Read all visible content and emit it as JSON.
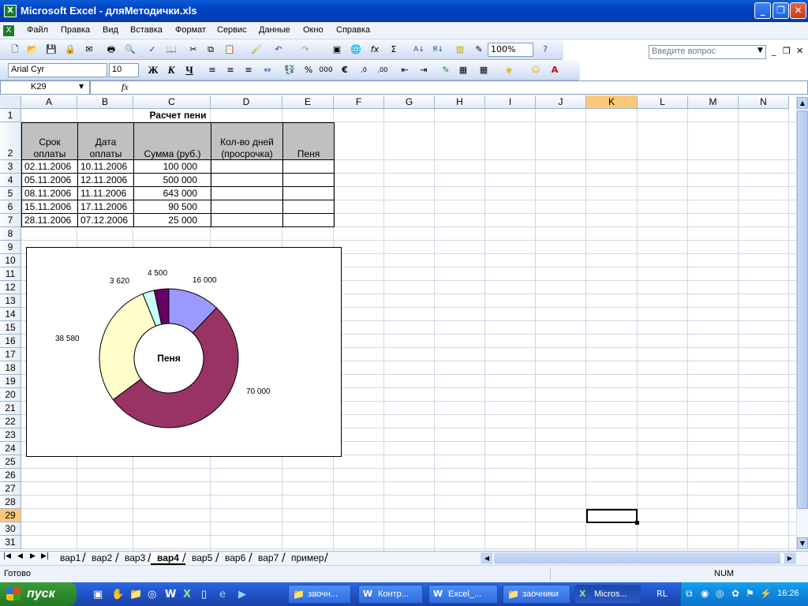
{
  "window": {
    "title": "Microsoft Excel - дляМетодички.xls"
  },
  "menu": {
    "items": [
      "Файл",
      "Правка",
      "Вид",
      "Вставка",
      "Формат",
      "Сервис",
      "Данные",
      "Окно",
      "Справка"
    ],
    "ask_placeholder": "Введите вопрос"
  },
  "toolbar": {
    "zoom": "100%"
  },
  "format_toolbar": {
    "font": "Arial Cyr",
    "size": "10",
    "bold": "Ж",
    "italic": "К",
    "underline": "Ч"
  },
  "formula_bar": {
    "name_box": "K29",
    "fx": "fx",
    "value": ""
  },
  "sheet": {
    "columns": [
      "A",
      "B",
      "C",
      "D",
      "E",
      "F",
      "G",
      "H",
      "I",
      "J",
      "K",
      "L",
      "M",
      "N"
    ],
    "selected_column": "K",
    "selected_row": "29",
    "rows": [
      "1",
      "2",
      "3",
      "4",
      "5",
      "6",
      "7",
      "8",
      "9",
      "10",
      "11",
      "12",
      "13",
      "14",
      "15",
      "16",
      "17",
      "18",
      "19",
      "20",
      "21",
      "22",
      "23",
      "24",
      "25",
      "26",
      "27",
      "28",
      "29",
      "30",
      "31"
    ],
    "title": "Расчет пени",
    "headers": {
      "a1": "Срок",
      "a2": "оплаты",
      "b1": "Дата",
      "b2": "оплаты",
      "c": "Сумма (руб.)",
      "d1": "Кол-во дней",
      "d2": "(просрочка)",
      "e": "Пеня"
    },
    "data": [
      {
        "a": "02.11.2006",
        "b": "10.11.2006",
        "c": "100 000"
      },
      {
        "a": "05.11.2006",
        "b": "12.11.2006",
        "c": "500 000"
      },
      {
        "a": "08.11.2006",
        "b": "11.11.2006",
        "c": "643 000"
      },
      {
        "a": "15.11.2006",
        "b": "17.11.2006",
        "c": "90 500"
      },
      {
        "a": "28.11.2006",
        "b": "07.12.2006",
        "c": "25 000"
      }
    ]
  },
  "chart_data": {
    "type": "pie",
    "title": "Пеня",
    "categories": [
      "",
      "",
      "",
      "",
      ""
    ],
    "values": [
      16000,
      70000,
      38580,
      3620,
      4500
    ],
    "labels": [
      "16 000",
      "70 000",
      "38 580",
      "3 620",
      "4 500"
    ],
    "colors": [
      "#9999ff",
      "#993366",
      "#ffffcc",
      "#ccffff",
      "#660066"
    ]
  },
  "tabs": {
    "items": [
      "вар1",
      "вар2",
      "вар3",
      "вар4",
      "вар5",
      "вар6",
      "вар7",
      "пример"
    ],
    "active": "вар4"
  },
  "status": {
    "left": "Готово",
    "num": "NUM"
  },
  "taskbar": {
    "start": "пуск",
    "tasks": [
      "заочн...",
      "Контр...",
      "Excel_...",
      "заочники",
      "Micros..."
    ],
    "lang": "RL",
    "clock": "16:26"
  }
}
